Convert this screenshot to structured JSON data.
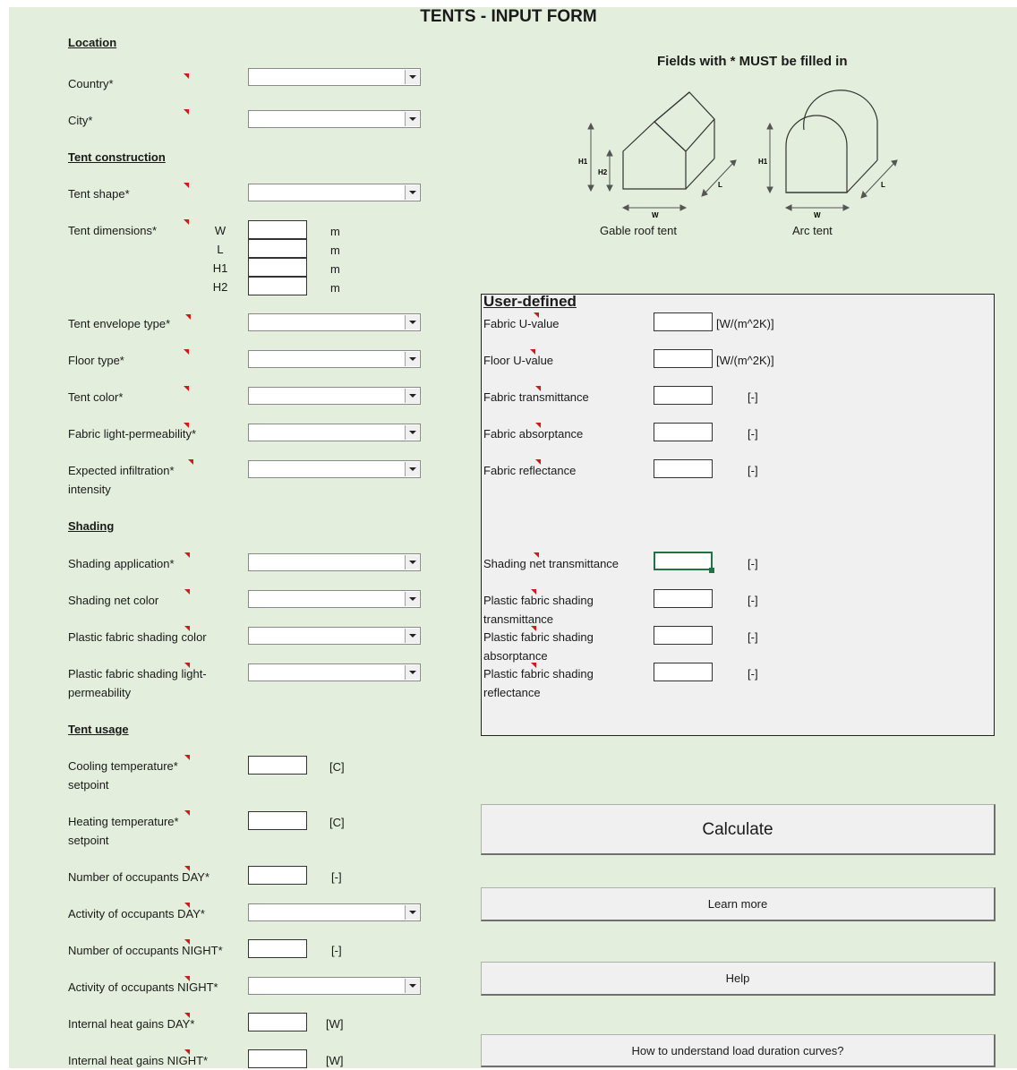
{
  "title": "TENTS - INPUT FORM",
  "required_note": "Fields with * MUST be filled in",
  "colors": {
    "sheet_bg": "#e3eedc",
    "comment_marker": "#d11a1a",
    "panel_bg": "#f0f0f0",
    "active_cell": "#217346"
  },
  "sections": {
    "location": "Location",
    "construction": "Tent construction",
    "shading": "Shading",
    "usage": "Tent usage"
  },
  "location": {
    "country": "Country*",
    "city": "City*"
  },
  "construction": {
    "shape": "Tent shape*",
    "dimensions": "Tent dimensions*",
    "dim_labels": [
      "W",
      "L",
      "H1",
      "H2"
    ],
    "dim_unit": "m",
    "envelope": "Tent envelope type*",
    "floor": "Floor type*",
    "color": "Tent color*",
    "light": "Fabric light-permeability*",
    "infiltration": "Expected infiltration* intensity"
  },
  "shading": {
    "application": "Shading application*",
    "net_color": "Shading net color",
    "plastic_color": "Plastic fabric shading color",
    "plastic_light": "Plastic fabric shading light-permeability"
  },
  "usage": {
    "cooling": "Cooling temperature* setpoint",
    "heating": "Heating temperature* setpoint",
    "occ_day": "Number of occupants DAY*",
    "act_day": "Activity of occupants DAY*",
    "occ_night": "Number of occupants NIGHT*",
    "act_night": "Activity of occupants NIGHT*",
    "gains_day": "Internal heat gains DAY*",
    "gains_night": "Internal heat gains NIGHT*",
    "unit_c": "[C]",
    "unit_none": "[-]",
    "unit_w": "[W]"
  },
  "diagram": {
    "gable_caption": "Gable roof tent",
    "arc_caption": "Arc tent",
    "h1": "H1",
    "h2": "H2",
    "w": "W",
    "l": "L"
  },
  "user_defined": {
    "title": "User-defined",
    "rows": [
      {
        "label": "Fabric U-value",
        "unit": "[W/(m^2K)]"
      },
      {
        "label": "Floor U-value",
        "unit": "[W/(m^2K)]"
      },
      {
        "label": "Fabric transmittance",
        "unit": "[-]"
      },
      {
        "label": "Fabric absorptance",
        "unit": "[-]"
      },
      {
        "label": "Fabric reflectance",
        "unit": "[-]"
      },
      {
        "label": "Shading net transmittance",
        "unit": "[-]"
      },
      {
        "label": "Plastic fabric shading transmittance",
        "unit": "[-]"
      },
      {
        "label": "Plastic fabric shading absorptance",
        "unit": "[-]"
      },
      {
        "label": "Plastic fabric shading reflectance",
        "unit": "[-]"
      }
    ]
  },
  "buttons": {
    "calculate": "Calculate",
    "learn_more": "Learn more",
    "help": "Help",
    "load_curves": "How to understand load duration curves?"
  }
}
